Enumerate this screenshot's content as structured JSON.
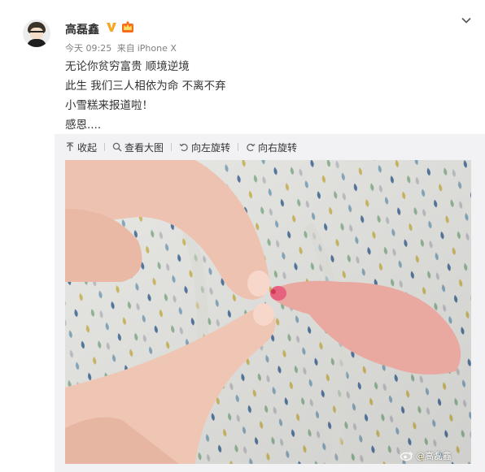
{
  "post": {
    "username": "高磊鑫",
    "timestamp": "今天 09:25",
    "source_prefix": "来自",
    "source": "iPhone X",
    "lines": [
      "无论你贫穷富贵 顺境逆境",
      "此生 我们三人相依为命 不离不弃",
      "小雪糕来报道啦！",
      "感恩...."
    ]
  },
  "toolbar": {
    "collapse": "收起",
    "view_large": "查看大图",
    "rotate_left": "向左旋转",
    "rotate_right": "向右旋转"
  },
  "watermark": "@高磊鑫",
  "icons": {
    "verified": "verified-v-icon",
    "vip": "vip-crown-icon",
    "menu": "chevron-down-icon",
    "collapse": "arrow-up-icon",
    "zoom": "magnifier-icon",
    "rotate_left": "rotate-left-icon",
    "rotate_right": "rotate-right-icon"
  },
  "colors": {
    "verified": "#f5a623",
    "vip": "#f86d1c",
    "toolbar_bg": "#f2f2f5",
    "text": "#333333",
    "meta": "#808080"
  }
}
